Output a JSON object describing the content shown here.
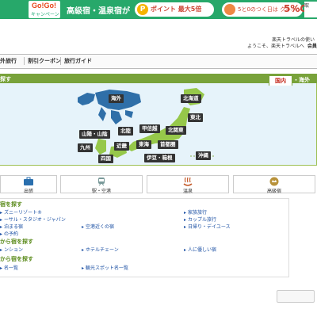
{
  "banner": {
    "gogo_top": "Go!Go!",
    "gogo_bottom": "キャンペーン",
    "text": "高級宿・温泉宿が",
    "point_icon": "P",
    "point_text": "ポイント 最大5倍",
    "coupon_text": "5と0のつく日は クーポン",
    "coupon_big": "5%OFF",
    "right_chip": "取"
  },
  "header": {
    "links": "楽天トラベルの使い",
    "welcome": "ようこそ、楽天トラベルへ",
    "member": "会員"
  },
  "nav": {
    "items": [
      "外旅行",
      "割引クーポン",
      "旅行ガイド"
    ]
  },
  "map": {
    "title": "探す",
    "tab_domestic": "国内",
    "tab_overseas": "・海外",
    "regions": {
      "overseas": "海外",
      "hokkaido": "北海道",
      "tohoku": "東北",
      "kitakanto": "北関東",
      "koshinetsu": "甲信越",
      "hokuriku": "北陸",
      "sanyo_sanin": "山陽・山陰",
      "kyushu": "九州",
      "kinki": "近畿",
      "tokai": "東海",
      "shutoken": "首都圏",
      "shikoku": "四国",
      "izu_hakone": "伊豆・箱根",
      "okinawa": "沖縄"
    }
  },
  "tiles": [
    {
      "label": "出張",
      "icon": "briefcase-icon"
    },
    {
      "label": "駅・空港",
      "icon": "train-icon"
    },
    {
      "label": "温泉",
      "icon": "hot-spring-icon"
    },
    {
      "label": "高級宿",
      "icon": "luxury-icon"
    }
  ],
  "search": {
    "sec1_title": "宿を探す",
    "sec1_links": [
      "ズニーリゾート®",
      "ーサル・スタジオ・ジャパン",
      "泊まる宿",
      "の予約",
      "家族旅行",
      "カップル旅行",
      "空港近くの宿",
      "日帰り・デイユース"
    ],
    "sec2_title": "から宿を探す",
    "sec2_links": [
      "ンション",
      "ホテルチェーン",
      "人に優しい宿"
    ],
    "sec3_title": "から宿を探す",
    "sec3_links": [
      "名一覧",
      "観光スポット名一覧"
    ]
  },
  "colors": {
    "banner_green": "#27a86a",
    "map_green": "#78a23a",
    "map_bg": "#e6f3fa",
    "land": "#96c84a",
    "link_blue": "#1a4fa3",
    "domestic_red": "#c4281c"
  }
}
